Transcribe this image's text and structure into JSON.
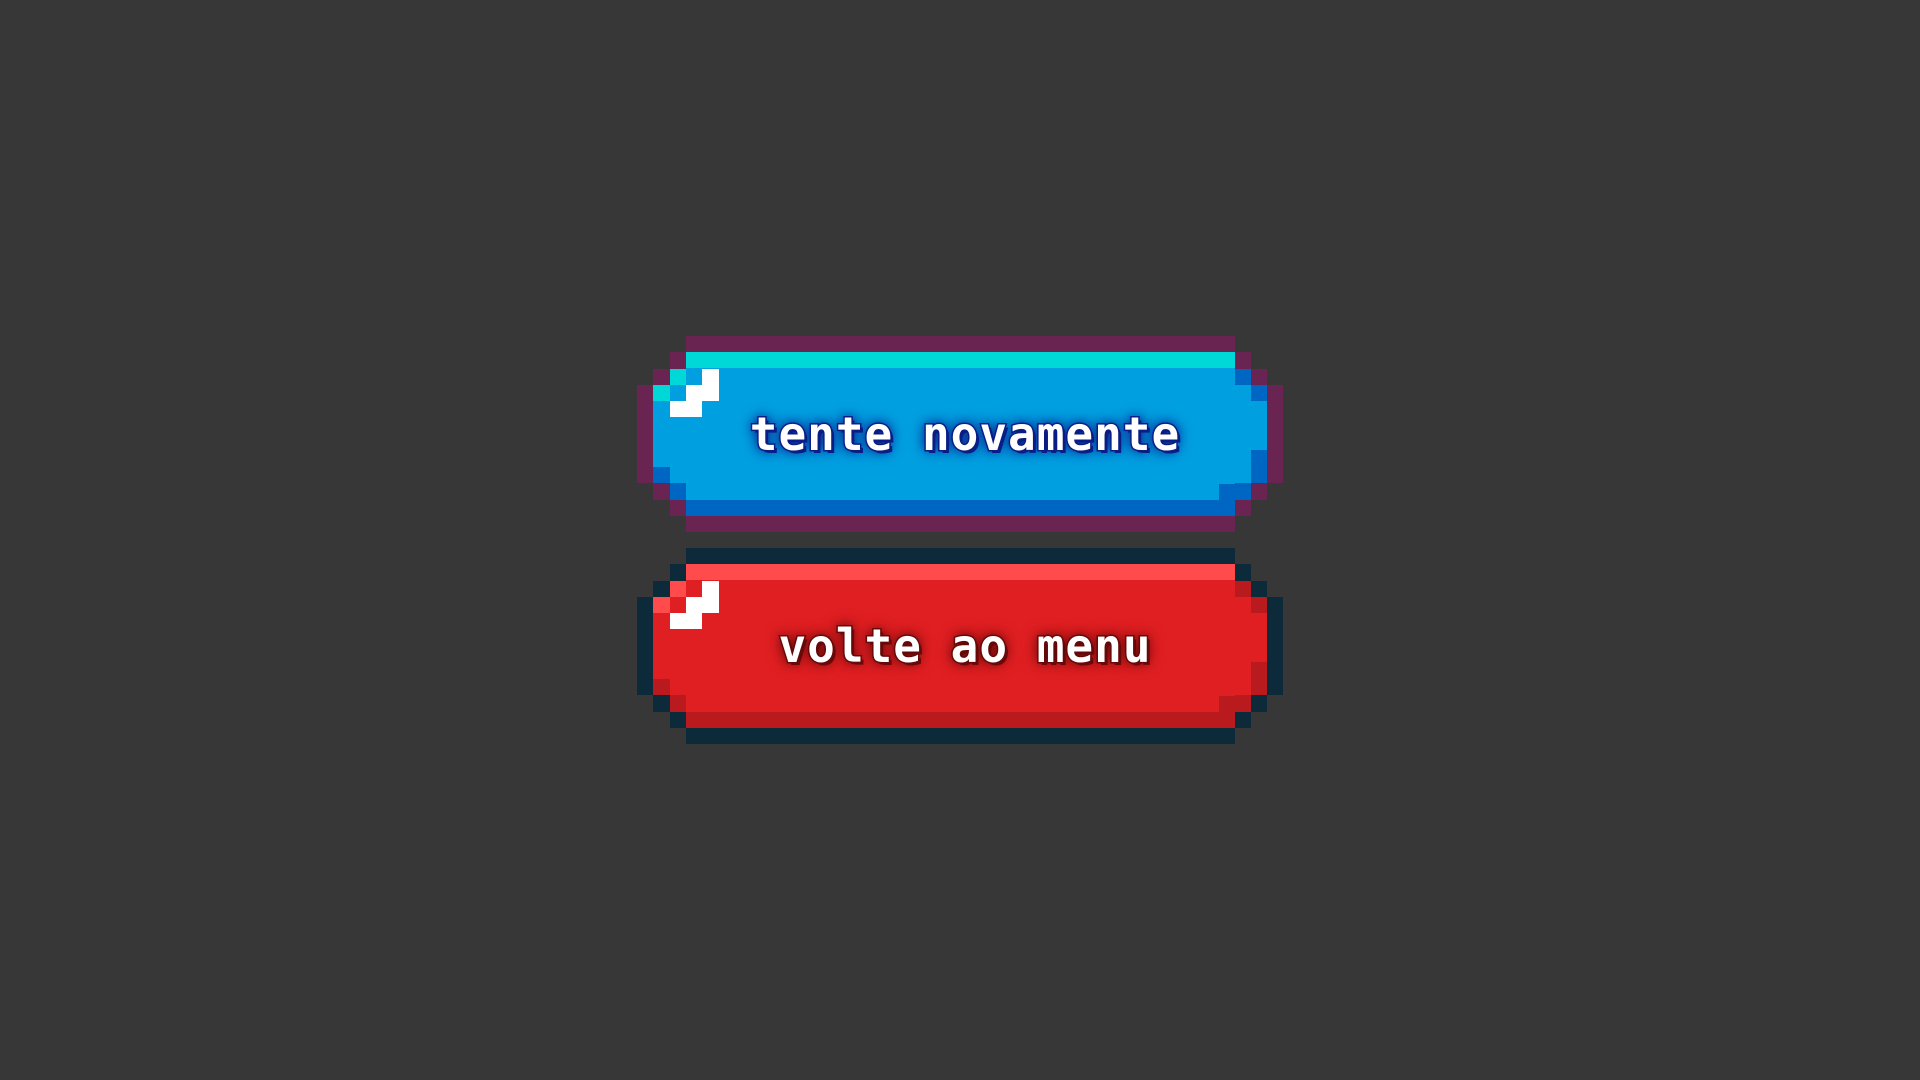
{
  "buttons": {
    "retry": {
      "label": "tente novamente"
    },
    "menu": {
      "label": "volte ao menu"
    }
  },
  "colors": {
    "background": "#373737",
    "retry_outline": "#6a2452",
    "retry_top_highlight": "#00d8d8",
    "retry_fill": "#00a0e0",
    "retry_shadow": "#0066c4",
    "retry_text_outline": "#0c1f86",
    "menu_outline": "#0c2a3a",
    "menu_top_highlight": "#ff4b4b",
    "menu_fill": "#e01f22",
    "menu_shadow": "#b81a1e",
    "menu_text_outline": "#6e0b0b",
    "shine": "#ffffff"
  },
  "icons": {
    "shine": "corner-shine-icon"
  }
}
